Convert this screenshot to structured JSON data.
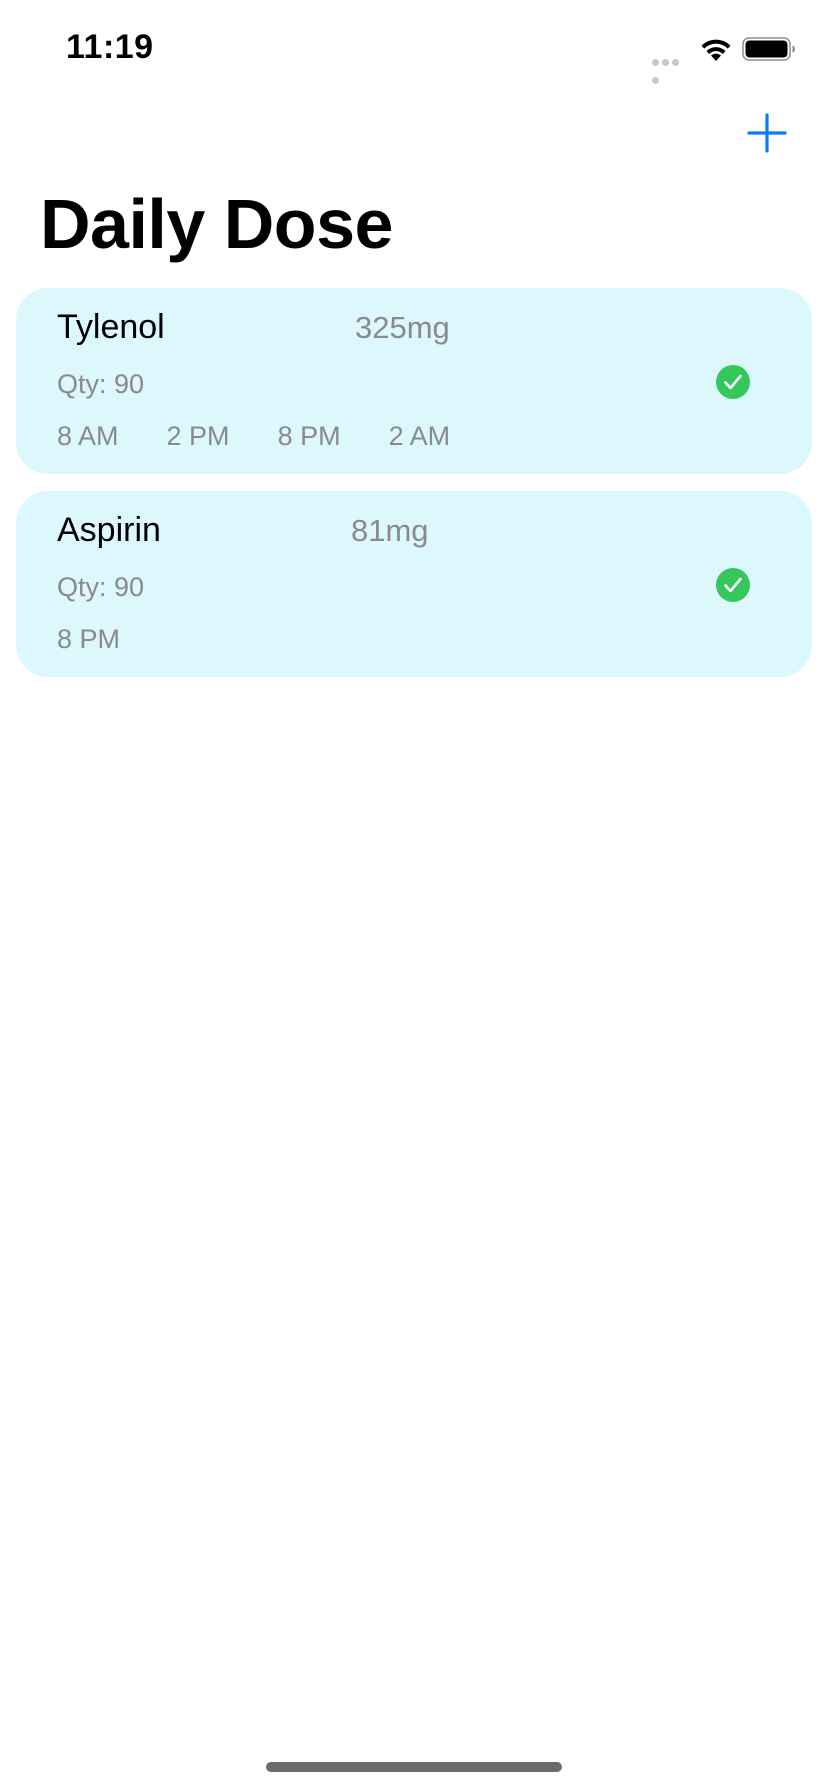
{
  "status_bar": {
    "time": "11:19"
  },
  "nav": {
    "title": "Daily Dose",
    "add_icon": "plus-icon",
    "accent_color": "#0a7aff"
  },
  "medications": [
    {
      "name": "Tylenol",
      "dose": "325mg",
      "qty": "Qty: 90",
      "times": [
        "8 AM",
        "2 PM",
        "8 PM",
        "2 AM"
      ],
      "taken": true
    },
    {
      "name": "Aspirin",
      "dose": "81mg",
      "qty": "Qty: 90",
      "times": [
        "8 PM"
      ],
      "taken": true
    }
  ],
  "colors": {
    "card_background": "#dcf8fd",
    "check_green": "#34c759",
    "secondary_text": "#8a8a8e"
  }
}
